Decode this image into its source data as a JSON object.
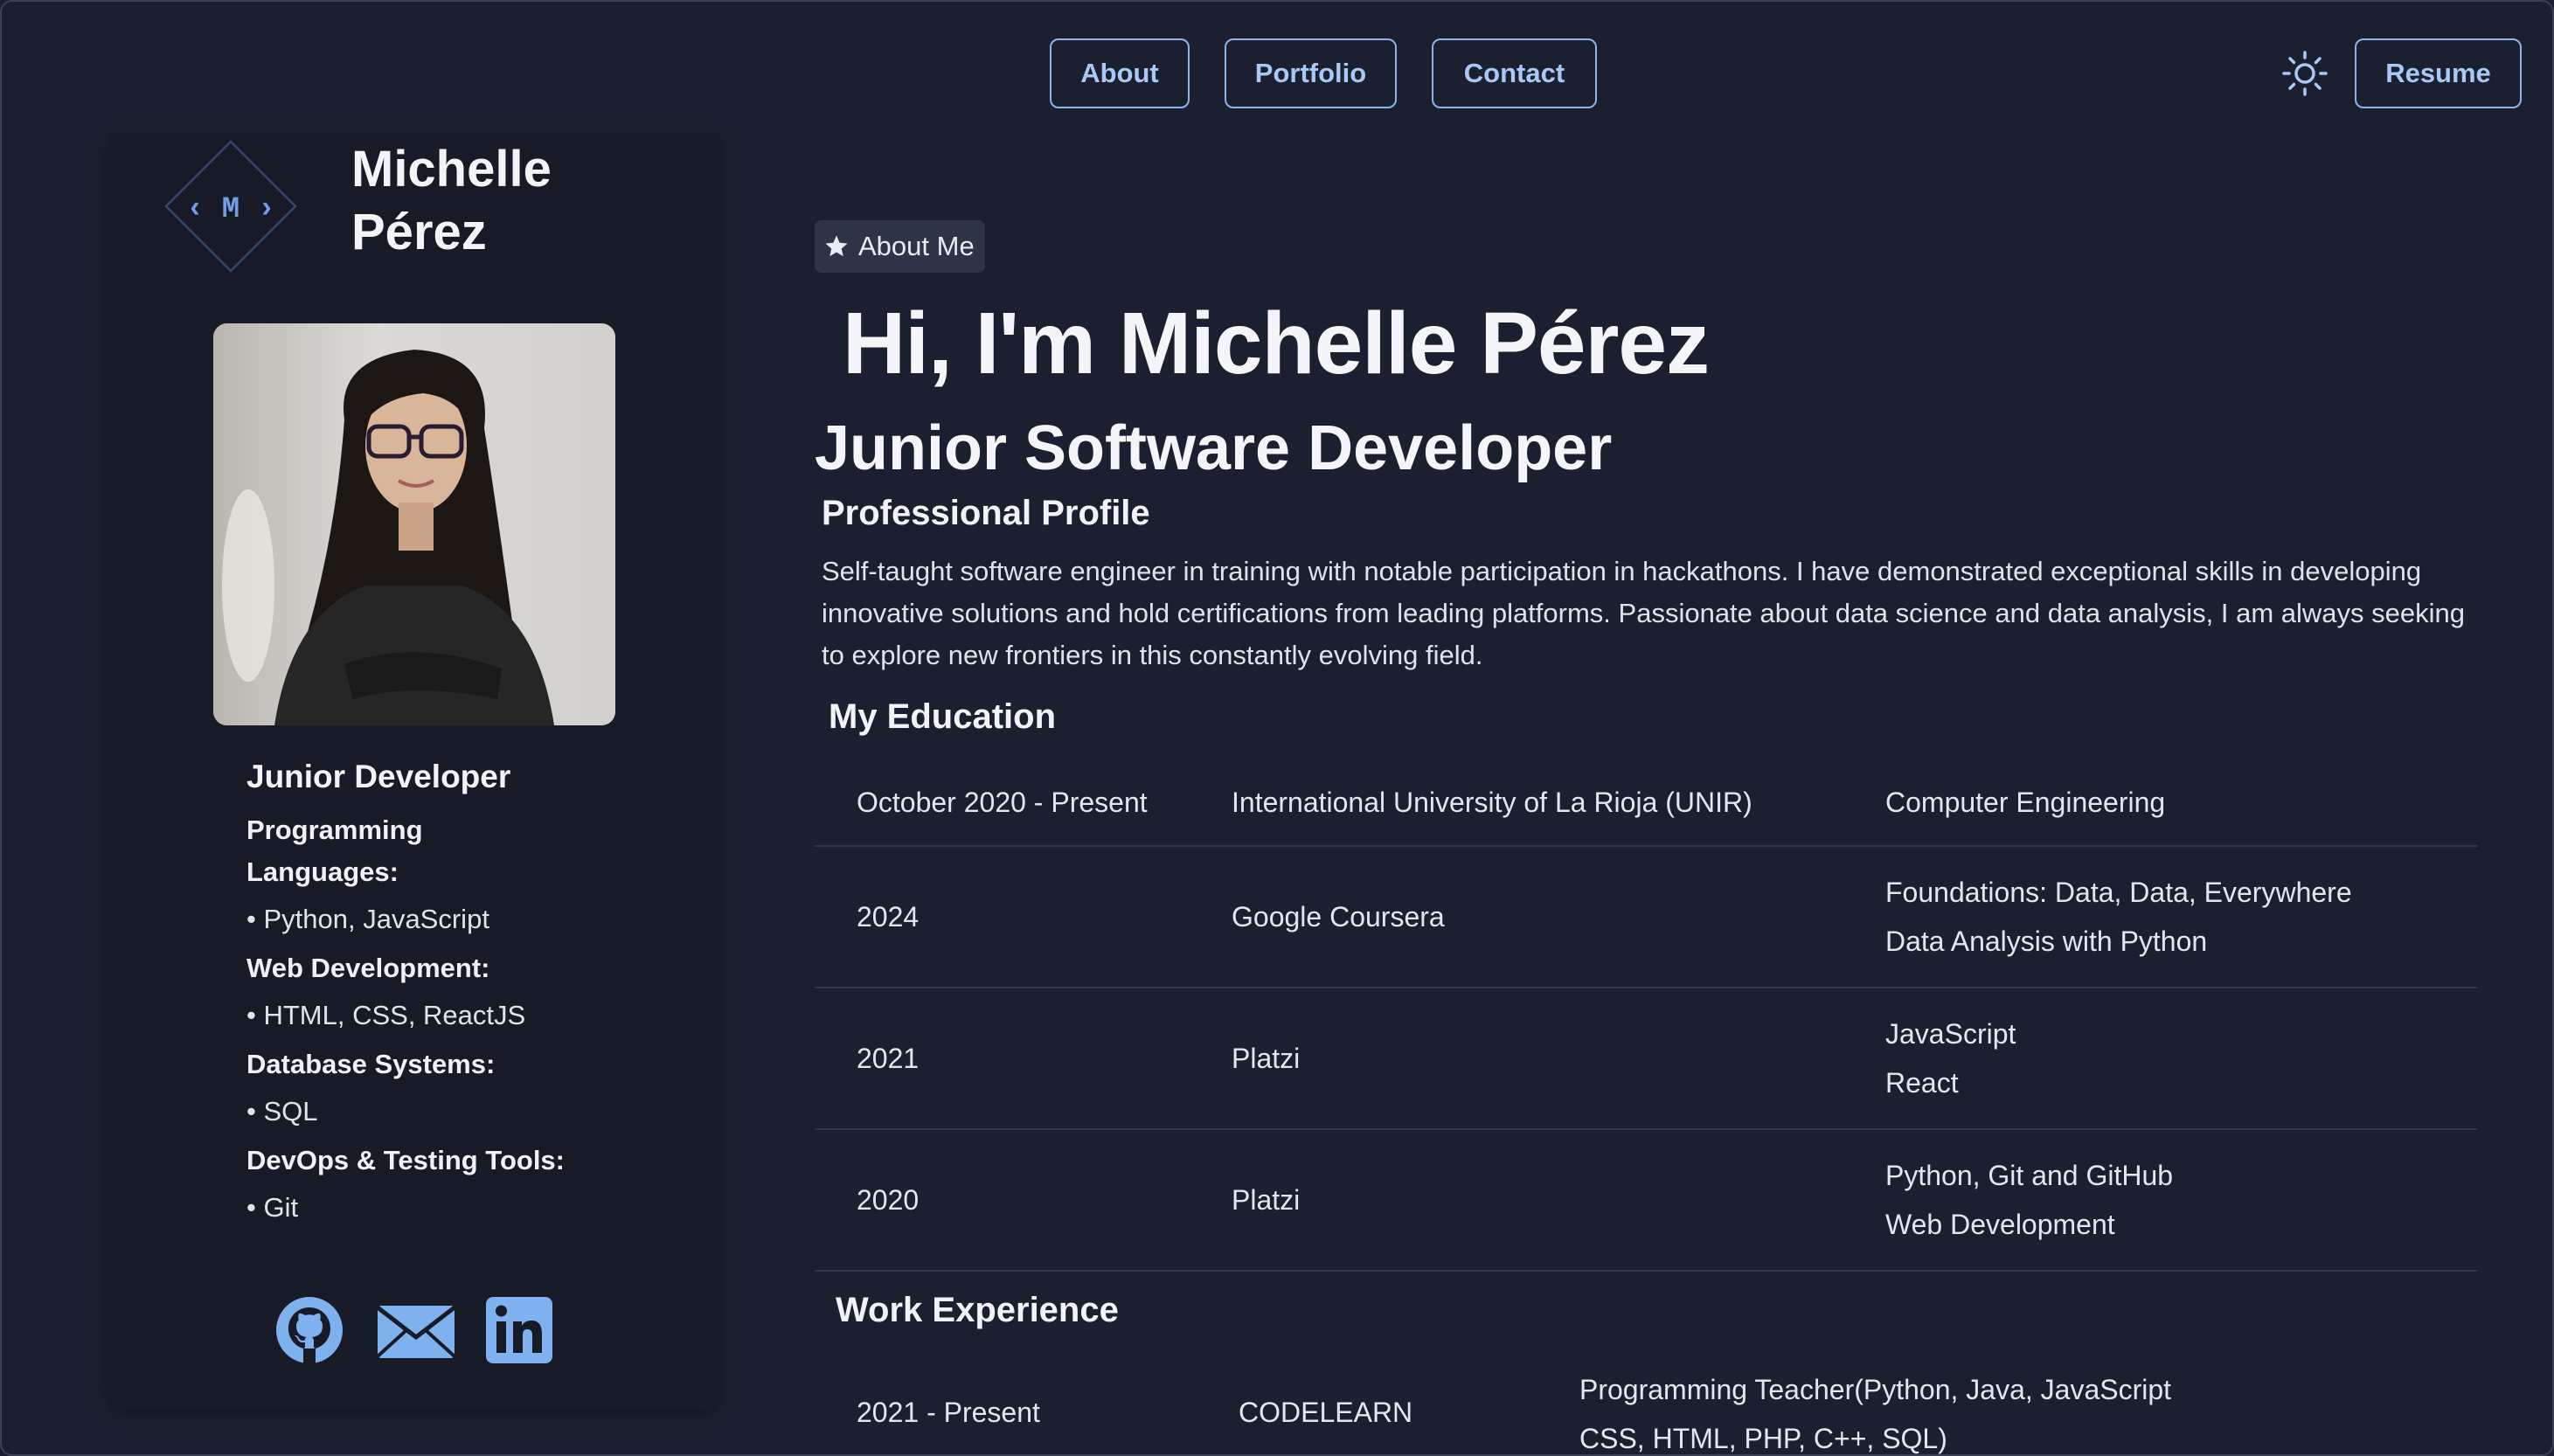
{
  "nav": {
    "about": "About",
    "portfolio": "Portfolio",
    "contact": "Contact",
    "resume": "Resume",
    "theme_icon": "sun-icon"
  },
  "sidebar": {
    "logo_text": "‹ M ›",
    "name_line1": "Michelle",
    "name_line2": "Pérez",
    "role": "Junior Developer",
    "skills": [
      {
        "category": "Programming Languages:",
        "items": "• Python, JavaScript"
      },
      {
        "category": "Web Development:",
        "items": "• HTML, CSS, ReactJS"
      },
      {
        "category": "Database Systems:",
        "items": "• SQL"
      },
      {
        "category": "DevOps & Testing Tools:",
        "items": "• Git"
      }
    ],
    "social_icons": [
      "github-icon",
      "mail-icon",
      "linkedin-icon"
    ]
  },
  "main": {
    "chip_label": "About Me",
    "greeting": "Hi, I'm Michelle Pérez",
    "title": "Junior Software Developer",
    "profile_heading": "Professional Profile",
    "profile_text": "Self-taught software engineer in training with notable participation in hackathons. I have demonstrated exceptional skills in developing innovative solutions and hold certifications from leading platforms. Passionate about data science and data analysis, I am always seeking to explore new frontiers in this constantly evolving field.",
    "education_heading": "My Education",
    "education": [
      {
        "date": "October 2020 - Present",
        "institution": "International University of La Rioja (UNIR)",
        "programs": [
          "Computer Engineering"
        ]
      },
      {
        "date": "2024",
        "institution": "Google Coursera",
        "programs": [
          "Foundations: Data, Data, Everywhere",
          "Data Analysis with Python"
        ]
      },
      {
        "date": "2021",
        "institution": "Platzi",
        "programs": [
          "JavaScript",
          "React"
        ]
      },
      {
        "date": "2020",
        "institution": "Platzi",
        "programs": [
          "Python, Git and GitHub",
          "Web Development"
        ]
      }
    ],
    "work_heading": "Work Experience",
    "work": [
      {
        "date": "2021 - Present",
        "company": "CODELEARN",
        "role_line1": "Programming Teacher(Python, Java, JavaScript",
        "role_line2": "CSS, HTML, PHP, C++, SQL)"
      }
    ]
  },
  "colors": {
    "background": "#1b2030",
    "sidebar": "#161b27",
    "accent": "#8cb4ee",
    "icon_blue": "#7fb1ef"
  }
}
